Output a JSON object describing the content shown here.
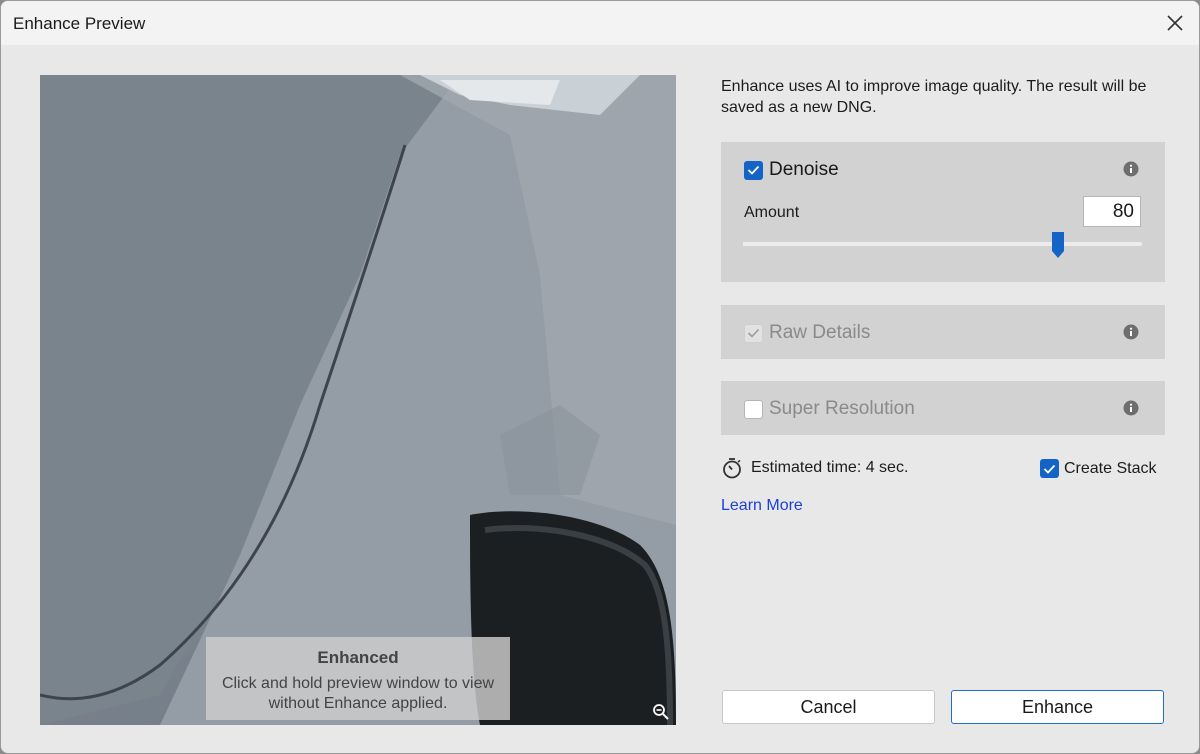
{
  "window": {
    "title": "Enhance Preview"
  },
  "preview": {
    "overlay_title": "Enhanced",
    "overlay_line1": "Click and hold preview window to view",
    "overlay_line2": "without Enhance applied."
  },
  "description": "Enhance uses AI to improve image quality. The result will be saved as a new DNG.",
  "denoise": {
    "label": "Denoise",
    "checked": true,
    "amount_label": "Amount",
    "amount_value": "80",
    "slider_fraction": 0.79
  },
  "raw_details": {
    "label": "Raw Details",
    "checked": true,
    "disabled": true
  },
  "super_resolution": {
    "label": "Super Resolution",
    "checked": false
  },
  "estimated_time": "Estimated time: 4 sec.",
  "create_stack": {
    "label": "Create Stack",
    "checked": true
  },
  "learn_more": "Learn More",
  "buttons": {
    "cancel": "Cancel",
    "enhance": "Enhance"
  },
  "colors": {
    "accent": "#1464c8",
    "link": "#1a3fdc",
    "panel": "#d2d2d2",
    "background": "#e8e8e8"
  }
}
